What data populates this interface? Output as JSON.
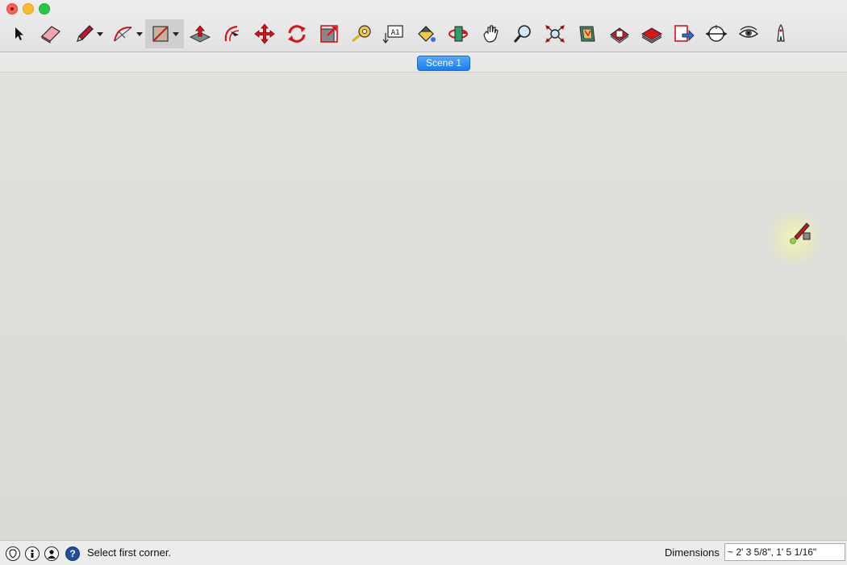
{
  "window": {
    "controls": [
      "close",
      "minimize",
      "maximize"
    ]
  },
  "toolbar": {
    "tools": [
      {
        "name": "select",
        "icon": "arrow-cursor-icon"
      },
      {
        "name": "eraser",
        "icon": "eraser-icon"
      },
      {
        "name": "line",
        "icon": "pencil-icon",
        "has_menu": true
      },
      {
        "name": "arc",
        "icon": "arc-icon",
        "has_menu": true
      },
      {
        "name": "rectangle",
        "icon": "rectangle-icon",
        "has_menu": true,
        "active": true
      },
      {
        "name": "push-pull",
        "icon": "push-pull-icon"
      },
      {
        "name": "offset",
        "icon": "offset-icon"
      },
      {
        "name": "move",
        "icon": "move-icon"
      },
      {
        "name": "rotate",
        "icon": "rotate-icon"
      },
      {
        "name": "scale",
        "icon": "scale-icon"
      },
      {
        "name": "tape-measure",
        "icon": "tape-measure-icon"
      },
      {
        "name": "text",
        "icon": "text-icon"
      },
      {
        "name": "paint-bucket",
        "icon": "paint-bucket-icon"
      },
      {
        "name": "orbit",
        "icon": "orbit-icon"
      },
      {
        "name": "pan",
        "icon": "hand-icon"
      },
      {
        "name": "zoom",
        "icon": "magnifier-icon"
      },
      {
        "name": "zoom-extents",
        "icon": "zoom-extents-icon"
      },
      {
        "name": "3d-warehouse",
        "icon": "warehouse-icon"
      },
      {
        "name": "extension-warehouse",
        "icon": "extension-icon"
      },
      {
        "name": "layout",
        "icon": "layout-icon"
      },
      {
        "name": "send-to-layout",
        "icon": "send-icon"
      },
      {
        "name": "position-camera",
        "icon": "position-camera-icon"
      },
      {
        "name": "look-around",
        "icon": "eye-icon"
      },
      {
        "name": "walk",
        "icon": "walk-icon"
      }
    ],
    "text_tool_glyph": "A1"
  },
  "scenes": {
    "tabs": [
      {
        "label": "Scene 1",
        "active": true
      }
    ]
  },
  "statusbar": {
    "icons": [
      "geo-location-icon",
      "credits-icon",
      "user-icon",
      "help-icon"
    ],
    "help_glyph": "?",
    "message": "Select first corner.",
    "dimensions_label": "Dimensions",
    "dimensions_value": "~ 2' 3 5/8\", 1' 5 1/16\""
  },
  "colors": {
    "accent": "#1a7cf2",
    "tool_red": "#d8131a",
    "viewport_bg": "#dcdcd9"
  }
}
